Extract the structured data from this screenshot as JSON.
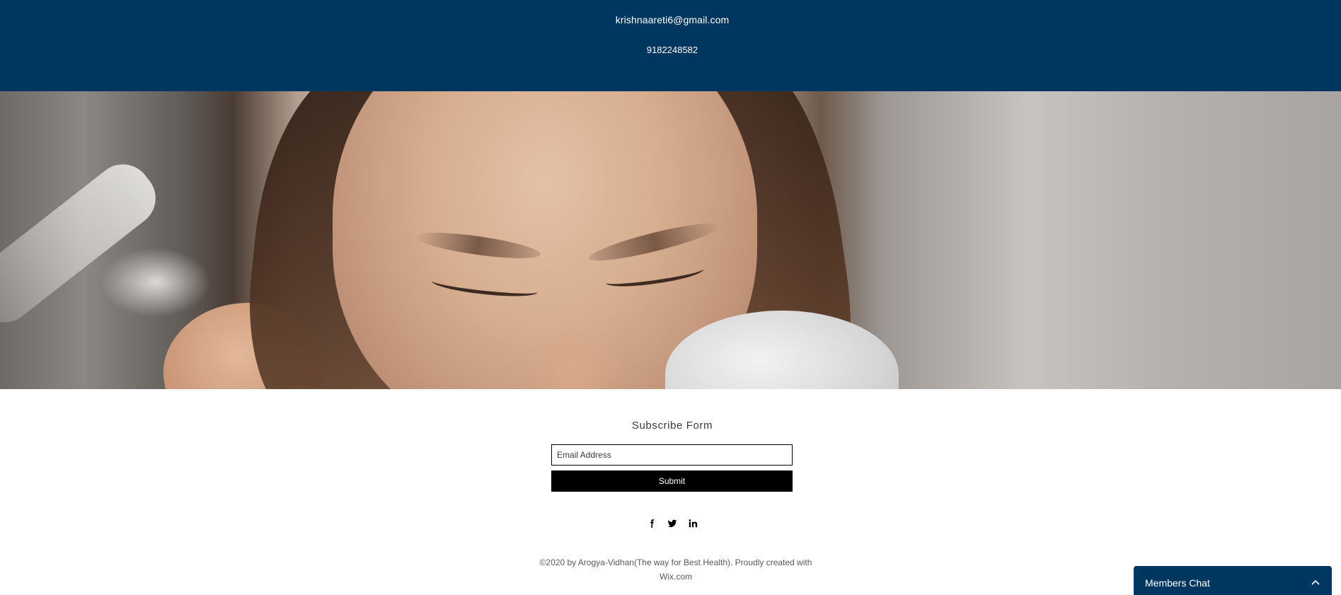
{
  "contact": {
    "email": "krishnaareti6@gmail.com",
    "phone": "9182248582"
  },
  "hero": {
    "image": "woman-with-closed-eyes-photo"
  },
  "subscribe": {
    "title": "Subscribe Form",
    "email_placeholder": "Email Address",
    "submit_label": "Submit"
  },
  "social": {
    "icons": [
      "facebook-icon",
      "twitter-icon",
      "linkedin-icon"
    ]
  },
  "footer": {
    "line1": "©2020 by Arogya-Vidhan(The way for Best Health). Proudly created with",
    "line2": "Wix.com"
  },
  "chat": {
    "label": "Members Chat",
    "icon": "chevron-up-icon"
  },
  "colors": {
    "brand_navy": "#003761",
    "button_black": "#000000"
  }
}
